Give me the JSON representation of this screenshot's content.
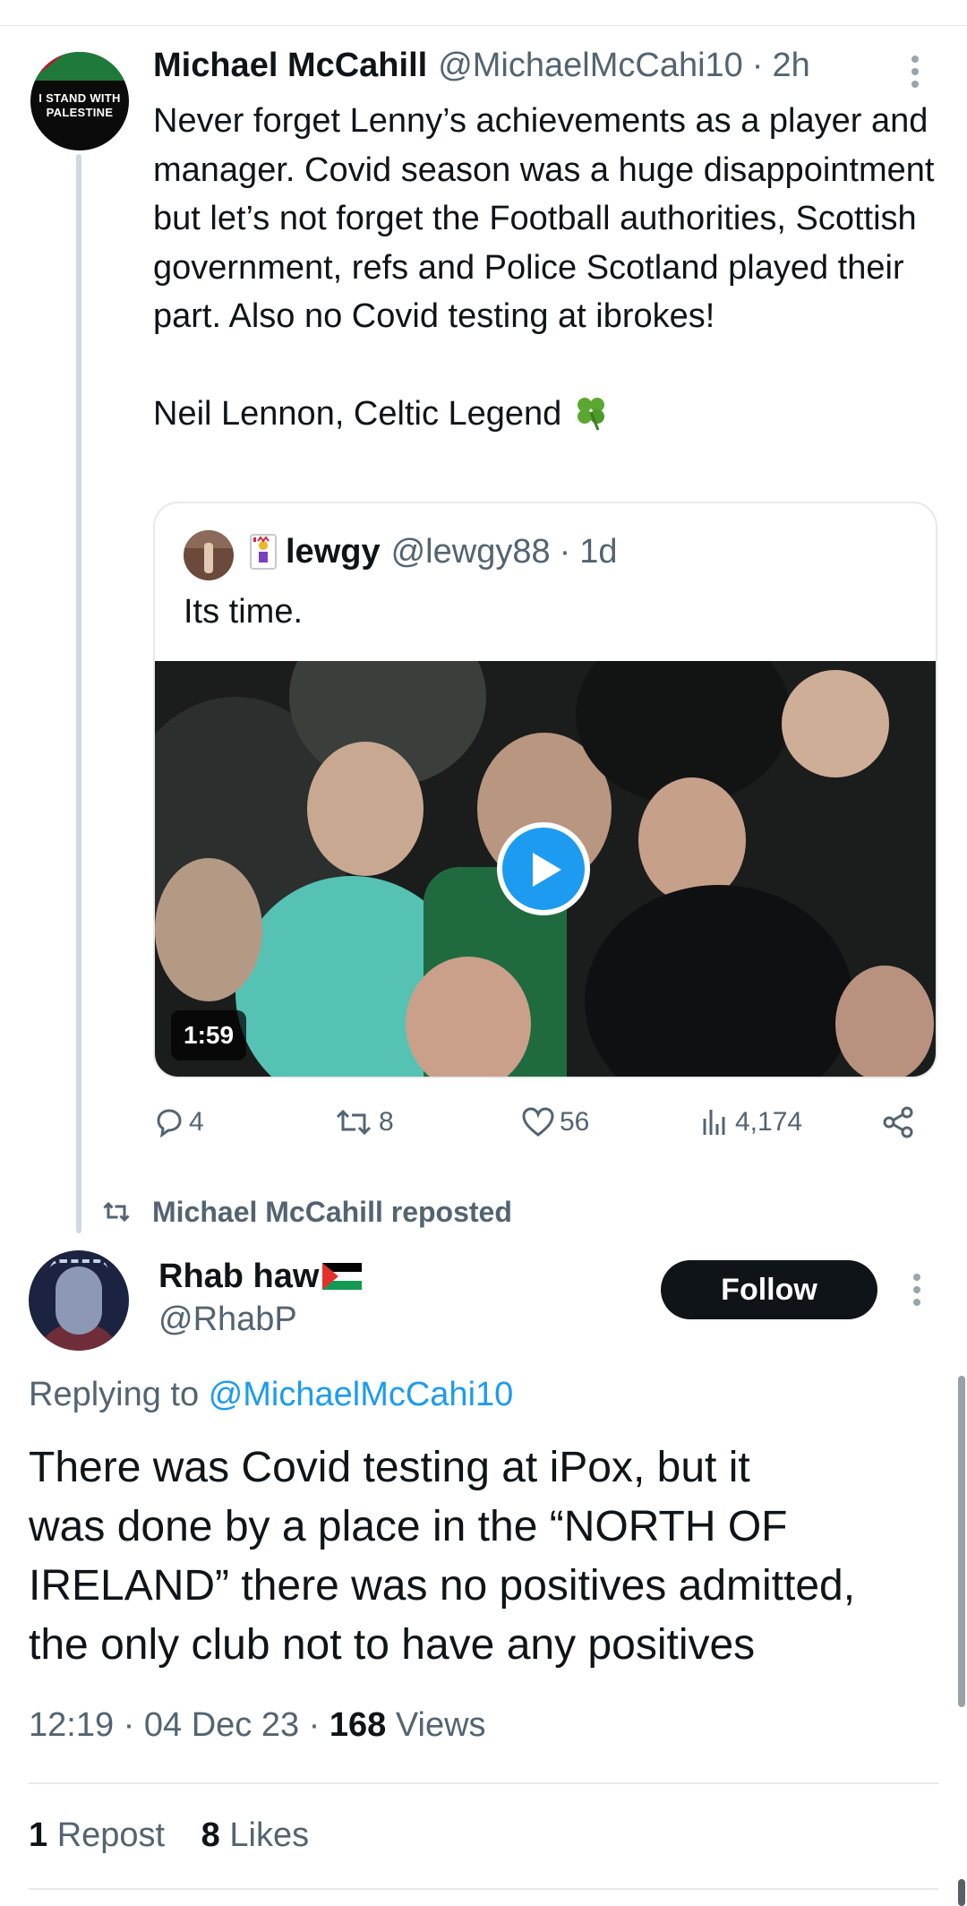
{
  "tweet1": {
    "avatar_text": "I STAND WITH PALESTINE",
    "name": "Michael McCahill",
    "handle": "@MichaelMcCahi10",
    "time": "2h",
    "text": "Never forget Lenny’s  achievements as a player and manager. Covid season was a huge disappointment but let’s not forget the Football authorities, Scottish government, refs and Police Scotland played their part. Also no Covid testing at ibrokes!\n\nNeil Lennon, Celtic Legend",
    "emoji_icon": "four-leaf-clover-icon",
    "quote": {
      "name": "lewgy",
      "handle": "@lewgy88",
      "time": "1d",
      "text": "Its time.",
      "video_duration": "1:59"
    },
    "actions": {
      "replies": "4",
      "reposts": "8",
      "likes": "56",
      "views": "4,174"
    }
  },
  "reposted_label": "Michael McCahill reposted",
  "tweet2": {
    "name": "Rhab haw",
    "handle": "@RhabP",
    "follow_label": "Follow",
    "replying_prefix": "Replying to",
    "replying_to": "@MichaelMcCahi10",
    "text": "There was Covid testing at iPox, but it\nwas done by a place in the “NORTH OF\nIRELAND” there was no positives admitted,\nthe only club not to have any positives",
    "time": "12:19",
    "date": "04 Dec 23",
    "views_count": "168",
    "views_label": "Views",
    "repost_count": "1",
    "repost_label": "Repost",
    "likes_count": "8",
    "likes_label": "Likes"
  },
  "colors": {
    "accent": "#1d9bf0",
    "text_primary": "#0f1419",
    "text_secondary": "#536471",
    "divider": "#e7e9ea"
  }
}
